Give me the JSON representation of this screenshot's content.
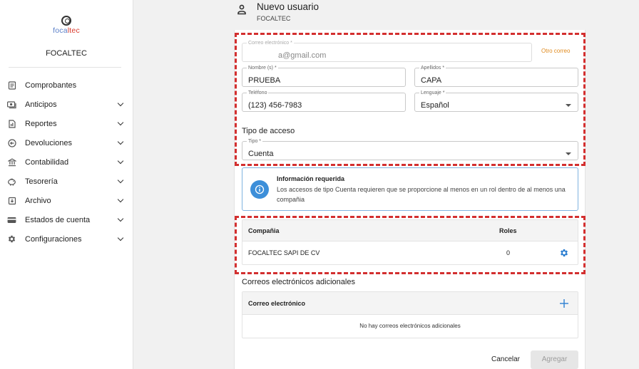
{
  "sidebar": {
    "logo": {
      "text_a": "foca",
      "text_b": "ltec"
    },
    "org_name": "FOCALTEC",
    "items": [
      {
        "label": "Comprobantes",
        "icon": "document-icon",
        "expandable": false
      },
      {
        "label": "Anticipos",
        "icon": "money-icon",
        "expandable": true
      },
      {
        "label": "Reportes",
        "icon": "report-icon",
        "expandable": true
      },
      {
        "label": "Devoluciones",
        "icon": "return-icon",
        "expandable": true
      },
      {
        "label": "Contabilidad",
        "icon": "bank-icon",
        "expandable": true
      },
      {
        "label": "Tesorería",
        "icon": "piggy-bank-icon",
        "expandable": true
      },
      {
        "label": "Archivo",
        "icon": "archive-icon",
        "expandable": true
      },
      {
        "label": "Estados de cuenta",
        "icon": "card-icon",
        "expandable": true
      },
      {
        "label": "Configuraciones",
        "icon": "gear-icon",
        "expandable": true
      }
    ]
  },
  "header": {
    "title": "Nuevo usuario",
    "subtitle": "FOCALTEC"
  },
  "form": {
    "email": {
      "label": "Correo electrónico *",
      "value": "a@gmail.com"
    },
    "otro_correo": "Otro correo",
    "nombre": {
      "label": "Nombre (s) *",
      "value": "PRUEBA"
    },
    "apellidos": {
      "label": "Apellidos *",
      "value": "CAPA"
    },
    "telefono": {
      "label": "Teléfono",
      "value": "(123) 456-7983"
    },
    "lenguaje": {
      "label": "Lenguaje *",
      "value": "Español"
    },
    "tipo_acceso_title": "Tipo de acceso",
    "tipo": {
      "label": "Tipo *",
      "value": "Cuenta"
    }
  },
  "info": {
    "title": "Información requerida",
    "text": "Los accesos de tipo Cuenta requieren que se proporcione al menos en un rol dentro de al menos una compañia"
  },
  "companies_table": {
    "headers": {
      "company": "Compañia",
      "roles": "Roles"
    },
    "rows": [
      {
        "company": "FOCALTEC SAPI DE CV",
        "roles": "0"
      }
    ]
  },
  "extra_emails": {
    "title": "Correos electrónicos adicionales",
    "header": "Correo electrónico",
    "empty_text": "No hay correos electrónicos adicionales"
  },
  "actions": {
    "cancel": "Cancelar",
    "add": "Agregar"
  },
  "colors": {
    "accent_orange": "#e08a1e",
    "info_blue": "#3d8fd9",
    "highlight_red": "#d32f2f"
  }
}
